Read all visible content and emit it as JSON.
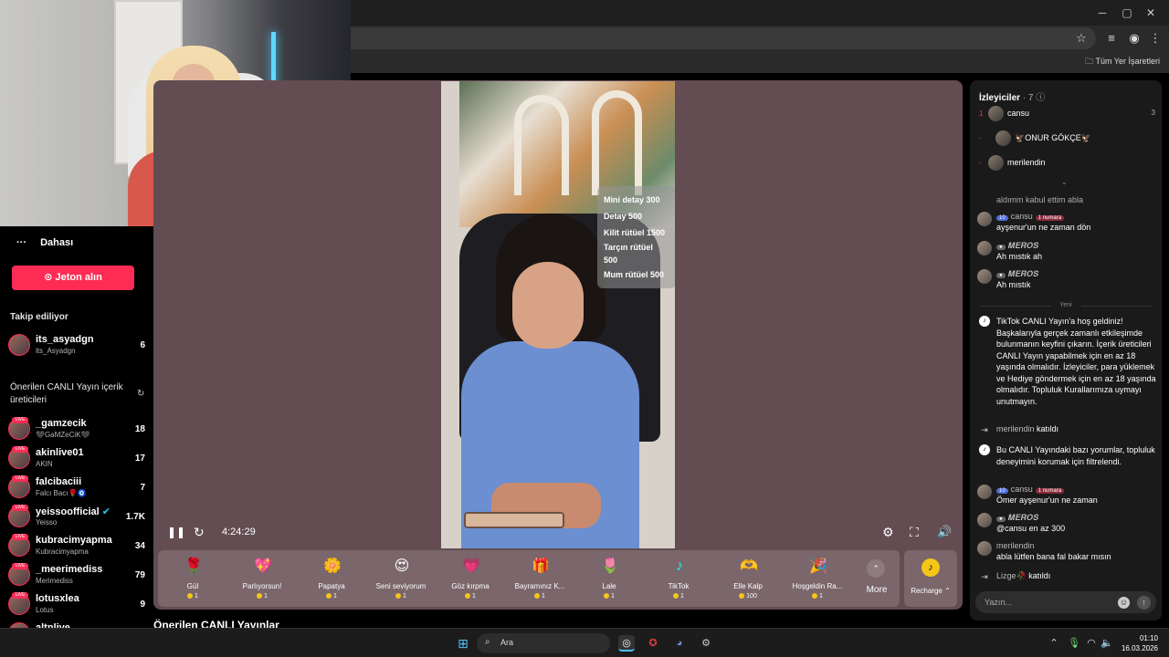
{
  "browser": {
    "window_controls": {
      "minimize": "─",
      "maximize": "▢",
      "close": "✕"
    },
    "bookmarks_all_label": "Tüm Yer İşaretleri"
  },
  "sidebar": {
    "more_label": "Dahası",
    "coins_button": "Jeton alın",
    "following_title": "Takip ediliyor",
    "following": [
      {
        "name": "its_asyadgn",
        "nick": "its_Asyadgn",
        "count": "6"
      }
    ],
    "suggested_title": "Önerilen CANLI Yayın içerik üreticileri",
    "suggested": [
      {
        "name": "_gamzecik",
        "nick": "🖤GaMZeCiK🖤",
        "count": "18"
      },
      {
        "name": "akinlive01",
        "nick": "AKIN",
        "count": "17"
      },
      {
        "name": "falcibaciii",
        "nick": "Falcı Bacı🌹🧿",
        "count": "7"
      },
      {
        "name": "yeissoofficial",
        "nick": "Yeisso",
        "count": "1.7K"
      },
      {
        "name": "kubracimyapma",
        "nick": "Kubracimyapma",
        "count": "34"
      },
      {
        "name": "_meerimediss",
        "nick": "Merimediss",
        "count": "79"
      },
      {
        "name": "lotusxlea",
        "nick": "Lotus",
        "count": "9"
      },
      {
        "name": "altnlive",
        "nick": "",
        "count": ""
      }
    ]
  },
  "video": {
    "menu_overlay": [
      "Mini detay 300",
      "Detay 500",
      "Kilit rütüel 1500",
      "Tarçın rütüel",
      "500",
      "Mum rütüel 500"
    ],
    "elapsed": "4:24:29"
  },
  "gifts": [
    {
      "name": "Gül",
      "price": "1",
      "icon": "🌹"
    },
    {
      "name": "Parlıyorsun!",
      "price": "1",
      "icon": "💖"
    },
    {
      "name": "Papatya",
      "price": "1",
      "icon": "🌼"
    },
    {
      "name": "Seni seviyorum",
      "price": "1",
      "icon": "😍"
    },
    {
      "name": "Göz kırpma",
      "price": "1",
      "icon": "💗"
    },
    {
      "name": "Bayramınız K...",
      "price": "1",
      "icon": "🎁"
    },
    {
      "name": "Lale",
      "price": "1",
      "icon": "🌷"
    },
    {
      "name": "TikTok",
      "price": "1",
      "icon": "♪"
    },
    {
      "name": "Elle Kalp",
      "price": "100",
      "icon": "🫶"
    },
    {
      "name": "Hoşgeldin Ra...",
      "price": "1",
      "icon": "🎉"
    }
  ],
  "gift_more_label": "More",
  "recharge_label": "Recharge",
  "recommended_title": "Önerilen CANLI Yayınlar",
  "chat": {
    "viewers_title": "İzleyiciler",
    "viewers_count": "· 7",
    "viewers": [
      {
        "rank": "1",
        "name": "cansu",
        "count": "3"
      },
      {
        "rank": "-",
        "name": "🦅ONUR GÖKÇE🦅",
        "count": ""
      },
      {
        "rank": "-",
        "name": "merilendin",
        "count": ""
      }
    ],
    "messages": [
      {
        "user": "",
        "text": "aldımm kabul ettim abla"
      },
      {
        "user": "cansu",
        "level": "10",
        "fan": "1 numara",
        "text": "ayşenur'un ne zaman dön"
      },
      {
        "user": "𝑴𝑬𝑹𝑶𝑺",
        "text": "Ah mıstık ah"
      },
      {
        "user": "𝑴𝑬𝑹𝑶𝑺",
        "text": "Ah mıstık"
      }
    ],
    "new_divider": "Yeni",
    "system_welcome": "TikTok CANLI Yayın'a hoş geldiniz! Başkalarıyla gerçek zamanlı etkileşimde bulunmanın keyfini çıkarın. İçerik üreticileri CANLI Yayın yapabilmek için en az 18 yaşında olmalıdır. İzleyiciler, para yüklemek ve Hediye göndermek için en az 18 yaşında olmalıdır. Topluluk Kurallarımıza uymayı unutmayın.",
    "join1_user": "merilendin",
    "join1_text": "katıldı",
    "system_filter": "Bu CANLI Yayındaki bazı yorumlar, topluluk deneyimini korumak için filtrelendi.",
    "messages2": [
      {
        "user": "cansu",
        "level": "10",
        "fan": "1 numara",
        "text": "Ömer ayşenur'un ne zaman"
      },
      {
        "user": "𝑴𝑬𝑹𝑶𝑺",
        "text": "@cansu en az 300"
      },
      {
        "user": "merilendin",
        "text": "abla lütfen bana fal bakar mısın"
      }
    ],
    "join2_user": "Lizge🥀",
    "join2_text": "katıldı",
    "input_placeholder": "Yazın..."
  },
  "taskbar": {
    "search_placeholder": "Ara",
    "time": "01:10",
    "date": "16.03.2026"
  },
  "colors": {
    "accent": "#fe2c55",
    "video_bg": "#634d52",
    "chat_bg": "#1a1a1a"
  }
}
